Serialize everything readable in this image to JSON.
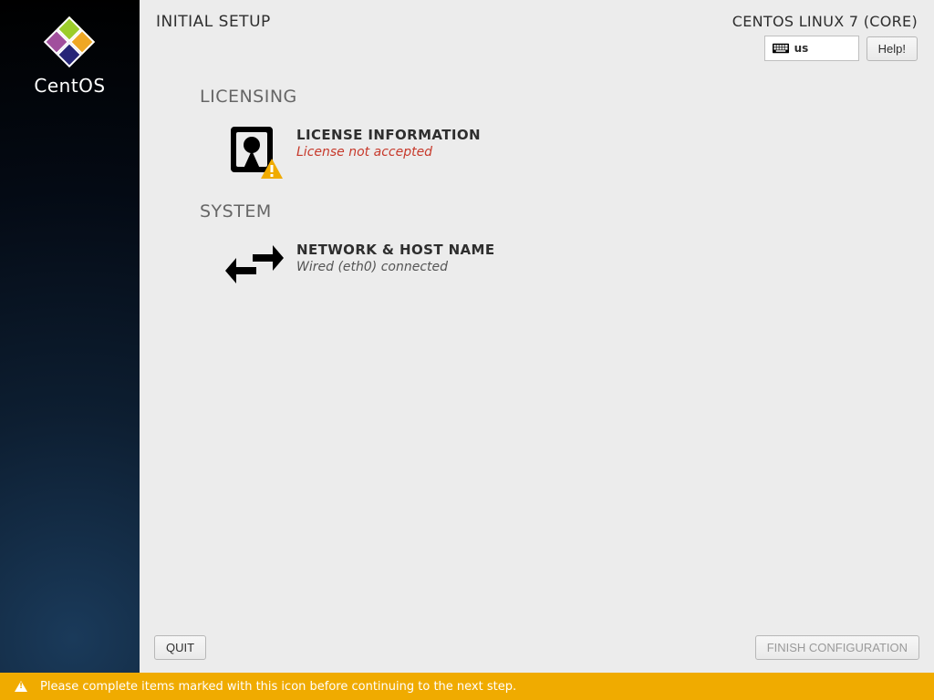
{
  "sidebar": {
    "product": "CentOS"
  },
  "header": {
    "title": "INITIAL SETUP",
    "distro": "CENTOS LINUX 7 (CORE)",
    "keyboard_layout": "us",
    "help_label": "Help!"
  },
  "sections": {
    "licensing": {
      "heading": "LICENSING",
      "license_info": {
        "title": "LICENSE INFORMATION",
        "status": "License not accepted",
        "warn": true
      }
    },
    "system": {
      "heading": "SYSTEM",
      "network": {
        "title": "NETWORK & HOST NAME",
        "status": "Wired (eth0) connected"
      }
    }
  },
  "footer": {
    "quit_label": "QUIT",
    "finish_label": "FINISH CONFIGURATION"
  },
  "banner": {
    "message": "Please complete items marked with this icon before continuing to the next step."
  }
}
